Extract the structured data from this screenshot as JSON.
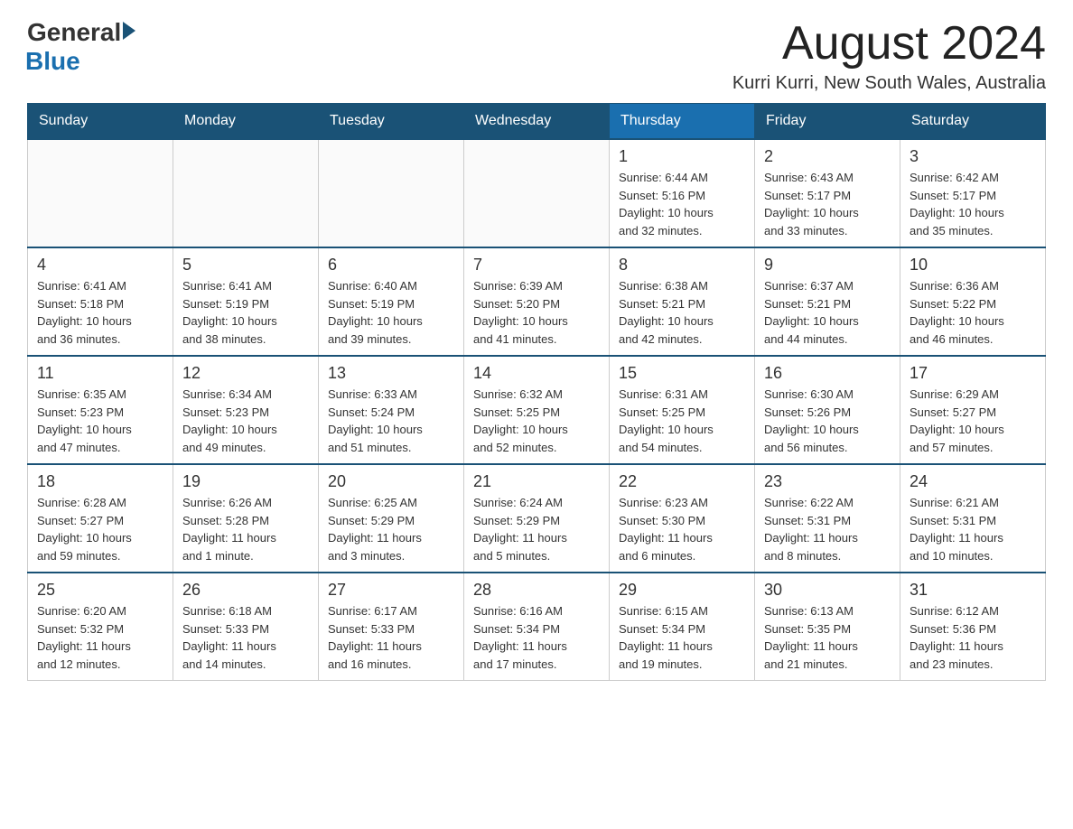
{
  "header": {
    "logo_general": "General",
    "logo_blue": "Blue",
    "month_title": "August 2024",
    "location": "Kurri Kurri, New South Wales, Australia"
  },
  "weekdays": [
    "Sunday",
    "Monday",
    "Tuesday",
    "Wednesday",
    "Thursday",
    "Friday",
    "Saturday"
  ],
  "weeks": [
    [
      {
        "day": "",
        "info": ""
      },
      {
        "day": "",
        "info": ""
      },
      {
        "day": "",
        "info": ""
      },
      {
        "day": "",
        "info": ""
      },
      {
        "day": "1",
        "info": "Sunrise: 6:44 AM\nSunset: 5:16 PM\nDaylight: 10 hours\nand 32 minutes."
      },
      {
        "day": "2",
        "info": "Sunrise: 6:43 AM\nSunset: 5:17 PM\nDaylight: 10 hours\nand 33 minutes."
      },
      {
        "day": "3",
        "info": "Sunrise: 6:42 AM\nSunset: 5:17 PM\nDaylight: 10 hours\nand 35 minutes."
      }
    ],
    [
      {
        "day": "4",
        "info": "Sunrise: 6:41 AM\nSunset: 5:18 PM\nDaylight: 10 hours\nand 36 minutes."
      },
      {
        "day": "5",
        "info": "Sunrise: 6:41 AM\nSunset: 5:19 PM\nDaylight: 10 hours\nand 38 minutes."
      },
      {
        "day": "6",
        "info": "Sunrise: 6:40 AM\nSunset: 5:19 PM\nDaylight: 10 hours\nand 39 minutes."
      },
      {
        "day": "7",
        "info": "Sunrise: 6:39 AM\nSunset: 5:20 PM\nDaylight: 10 hours\nand 41 minutes."
      },
      {
        "day": "8",
        "info": "Sunrise: 6:38 AM\nSunset: 5:21 PM\nDaylight: 10 hours\nand 42 minutes."
      },
      {
        "day": "9",
        "info": "Sunrise: 6:37 AM\nSunset: 5:21 PM\nDaylight: 10 hours\nand 44 minutes."
      },
      {
        "day": "10",
        "info": "Sunrise: 6:36 AM\nSunset: 5:22 PM\nDaylight: 10 hours\nand 46 minutes."
      }
    ],
    [
      {
        "day": "11",
        "info": "Sunrise: 6:35 AM\nSunset: 5:23 PM\nDaylight: 10 hours\nand 47 minutes."
      },
      {
        "day": "12",
        "info": "Sunrise: 6:34 AM\nSunset: 5:23 PM\nDaylight: 10 hours\nand 49 minutes."
      },
      {
        "day": "13",
        "info": "Sunrise: 6:33 AM\nSunset: 5:24 PM\nDaylight: 10 hours\nand 51 minutes."
      },
      {
        "day": "14",
        "info": "Sunrise: 6:32 AM\nSunset: 5:25 PM\nDaylight: 10 hours\nand 52 minutes."
      },
      {
        "day": "15",
        "info": "Sunrise: 6:31 AM\nSunset: 5:25 PM\nDaylight: 10 hours\nand 54 minutes."
      },
      {
        "day": "16",
        "info": "Sunrise: 6:30 AM\nSunset: 5:26 PM\nDaylight: 10 hours\nand 56 minutes."
      },
      {
        "day": "17",
        "info": "Sunrise: 6:29 AM\nSunset: 5:27 PM\nDaylight: 10 hours\nand 57 minutes."
      }
    ],
    [
      {
        "day": "18",
        "info": "Sunrise: 6:28 AM\nSunset: 5:27 PM\nDaylight: 10 hours\nand 59 minutes."
      },
      {
        "day": "19",
        "info": "Sunrise: 6:26 AM\nSunset: 5:28 PM\nDaylight: 11 hours\nand 1 minute."
      },
      {
        "day": "20",
        "info": "Sunrise: 6:25 AM\nSunset: 5:29 PM\nDaylight: 11 hours\nand 3 minutes."
      },
      {
        "day": "21",
        "info": "Sunrise: 6:24 AM\nSunset: 5:29 PM\nDaylight: 11 hours\nand 5 minutes."
      },
      {
        "day": "22",
        "info": "Sunrise: 6:23 AM\nSunset: 5:30 PM\nDaylight: 11 hours\nand 6 minutes."
      },
      {
        "day": "23",
        "info": "Sunrise: 6:22 AM\nSunset: 5:31 PM\nDaylight: 11 hours\nand 8 minutes."
      },
      {
        "day": "24",
        "info": "Sunrise: 6:21 AM\nSunset: 5:31 PM\nDaylight: 11 hours\nand 10 minutes."
      }
    ],
    [
      {
        "day": "25",
        "info": "Sunrise: 6:20 AM\nSunset: 5:32 PM\nDaylight: 11 hours\nand 12 minutes."
      },
      {
        "day": "26",
        "info": "Sunrise: 6:18 AM\nSunset: 5:33 PM\nDaylight: 11 hours\nand 14 minutes."
      },
      {
        "day": "27",
        "info": "Sunrise: 6:17 AM\nSunset: 5:33 PM\nDaylight: 11 hours\nand 16 minutes."
      },
      {
        "day": "28",
        "info": "Sunrise: 6:16 AM\nSunset: 5:34 PM\nDaylight: 11 hours\nand 17 minutes."
      },
      {
        "day": "29",
        "info": "Sunrise: 6:15 AM\nSunset: 5:34 PM\nDaylight: 11 hours\nand 19 minutes."
      },
      {
        "day": "30",
        "info": "Sunrise: 6:13 AM\nSunset: 5:35 PM\nDaylight: 11 hours\nand 21 minutes."
      },
      {
        "day": "31",
        "info": "Sunrise: 6:12 AM\nSunset: 5:36 PM\nDaylight: 11 hours\nand 23 minutes."
      }
    ]
  ]
}
